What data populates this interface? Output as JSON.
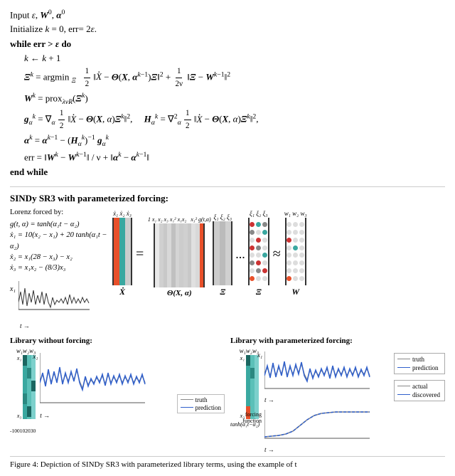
{
  "algo": {
    "input_line": "Input ε, W⁰, α⁰",
    "init_line": "Initialize k = 0, err= 2ε.",
    "while_line": "while err > ε do",
    "step1": "k ← k + 1",
    "step2_label": "Ξ",
    "step2_text": "= argmin",
    "step3": "W",
    "step4_g": "g",
    "step4_H": "H",
    "step5_alpha": "α",
    "err_line": "err = ‖W",
    "end_while": "end while"
  },
  "diagram": {
    "title": "SINDy SR3 with parameterized forcing:",
    "lorenz_label": "Lorenz forced by:",
    "g_eq": "g(t, α) = tanh(α₁t − α₂)",
    "x1_eq": "ẋ₁ = 10(x₂ − x₁) + 20 tanh(α₁t − α₂)",
    "x2_eq": "ẋ₂ = x₁(28 − x₃) − x₂",
    "x3_eq": "ẋ₃ = x₁x₂ − (8/3)x₃",
    "x1_label": "x₁",
    "t_arrow": "t →",
    "matrix_labels": {
      "xdot_cols": "ẋ₁ ẋ₂ ẋ₃",
      "theta_cols": "1 x₁ x₂ x₃ x₁² x₁x₂ ... x₃² g(t,α)",
      "xi_cols": "ξ₁ ξ₂ ξ₃",
      "xi2_cols": "ξ₁ ξ₂ ξ₃",
      "w_cols": "w₁ w₂ w₃"
    },
    "matrix_names": {
      "xdot": "Ẋ",
      "theta": "Θ(X, α)",
      "xi": "Ξ",
      "xi2": "Ξ",
      "w": "W"
    },
    "equals": "=",
    "approx": "≈",
    "dots": "..."
  },
  "library": {
    "left_title": "Library without forcing:",
    "right_title": "Library with parameterized forcing:",
    "w_label": "w₁w₂w₃",
    "x1_label": "x₁",
    "x3_label": "x₃",
    "t_arrow": "t →",
    "x_axis_values": [
      "-10",
      "0",
      "10",
      "20",
      "30"
    ],
    "legend_truth": "truth",
    "legend_pred": "prediction",
    "legend_actual": "actual",
    "legend_discovered": "discovered",
    "forcing_label": "forcing\nfunction",
    "tanh_label": "tanh(α₁t − α₂)"
  },
  "caption": "Figure 4:  Depiction of SINDy SR3 with parameterized library terms, using the example of t"
}
